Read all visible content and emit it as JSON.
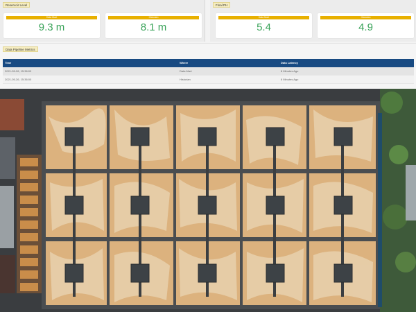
{
  "reservoir_panel": {
    "tag": "Reservoir Level",
    "cards": [
      {
        "label": "Data Mart",
        "value": "9.3 m"
      },
      {
        "label": "Historian",
        "value": "8.1 m"
      }
    ]
  },
  "final_ph_panel": {
    "tag": "Final PH",
    "cards": [
      {
        "label": "Data Mart",
        "value": "5.4"
      },
      {
        "label": "Historian",
        "value": "4.9"
      }
    ]
  },
  "metrics": {
    "tag": "Data Pipeline Metrics",
    "columns": [
      "Time",
      "Where",
      "Data Latency"
    ],
    "rows": [
      {
        "time": "2021-05-26, 15:36:00",
        "where": "Data Mart",
        "latency": "8 Minutes Ago"
      },
      {
        "time": "2021-05-26, 15:36:00",
        "where": "Historian",
        "latency": "6 Minutes Ago"
      }
    ]
  },
  "colors": {
    "accent_bar": "#e8b000",
    "value_green": "#3aa35a",
    "table_header": "#184a82"
  }
}
